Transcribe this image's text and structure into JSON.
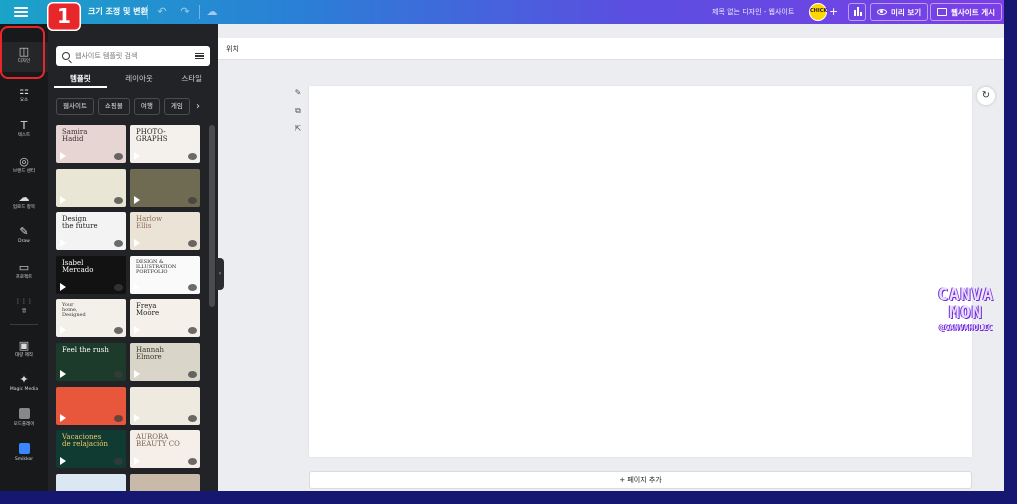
{
  "topbar": {
    "resize_label": "크기 조정 및 변환",
    "doc_title": "제목 없는 디자인 - 웹사이트",
    "avatar_text": "CHICK",
    "add_collaborator": "+",
    "preview_label": "미리 보기",
    "publish_label": "웹사이트 게시"
  },
  "step": {
    "number": "1"
  },
  "rail": {
    "items": [
      {
        "icon": "◫",
        "label": "디자인"
      },
      {
        "icon": "⚏",
        "label": "요소"
      },
      {
        "icon": "T",
        "label": "텍스트"
      },
      {
        "icon": "◎",
        "label": "브랜드 센터"
      },
      {
        "icon": "☁",
        "label": "업로드 항목"
      },
      {
        "icon": "✎",
        "label": "Draw"
      },
      {
        "icon": "▭",
        "label": "프로젝트"
      },
      {
        "icon": "⋮⋮⋮",
        "label": "앱"
      },
      {
        "icon": "▣",
        "label": "대량 제작"
      },
      {
        "icon": "✦",
        "label": "Magic Media"
      },
      {
        "icon": "■",
        "label": "모드플레이"
      },
      {
        "icon": "■",
        "label": "Smikkor"
      }
    ]
  },
  "panel": {
    "search_placeholder": "웹사이트 템플릿 검색",
    "tabs": [
      "템플릿",
      "레이아웃",
      "스타일"
    ],
    "chips": [
      "웹사이트",
      "쇼핑몰",
      "여행",
      "게임"
    ],
    "templates": [
      {
        "text": "Samira\nHadid",
        "bg": "#e7d5d3",
        "fg": "#3b2f2f"
      },
      {
        "text": "PHOTO-\nGRAPHS",
        "bg": "#f4f1ec",
        "fg": "#222"
      },
      {
        "text": "",
        "bg": "#eae6d5",
        "fg": "#6d6a55"
      },
      {
        "text": "",
        "bg": "#6e6b52",
        "fg": "#fff"
      },
      {
        "text": "Design\nthe future",
        "bg": "#f3f3f3",
        "fg": "#222"
      },
      {
        "text": "Harlow\nEllis",
        "bg": "#ece3d7",
        "fg": "#8b6d5a"
      },
      {
        "text": "Isabel\nMercado",
        "bg": "#121212",
        "fg": "#fff"
      },
      {
        "text": "DESIGN &\nILLUSTRATION\nPORTFOLIO",
        "bg": "#fafafa",
        "fg": "#222"
      },
      {
        "text": "Your\nhome,\nDesigned",
        "bg": "#f3efe9",
        "fg": "#333"
      },
      {
        "text": "Freya\nMoore",
        "bg": "#f5f1ea",
        "fg": "#222"
      },
      {
        "text": "Feel the rush",
        "bg": "#1d3b2a",
        "fg": "#fff"
      },
      {
        "text": "Hannah\nElmore",
        "bg": "#d9d5c8",
        "fg": "#3a3a2e"
      },
      {
        "text": "",
        "bg": "#e8573c",
        "fg": "#fff"
      },
      {
        "text": "",
        "bg": "#efeae0",
        "fg": "#5a5a4a"
      },
      {
        "text": "Vacaciones\nde relajación",
        "bg": "#0f3b33",
        "fg": "#f6c762"
      },
      {
        "text": "AURORA\nBEAUTY CO",
        "bg": "#f6eee8",
        "fg": "#7a5e4f"
      },
      {
        "text": "",
        "bg": "#dbe7f3",
        "fg": "#334"
      },
      {
        "text": "",
        "bg": "#c9b9a8",
        "fg": "#333"
      }
    ]
  },
  "editor": {
    "position_label": "위치",
    "add_page_label": "+ 페이지 추가"
  },
  "watermark": {
    "line1": "CANVA",
    "line2": "MON",
    "line3": "@CANVAHOLIC"
  },
  "colors": {
    "step_accent": "#e8272b",
    "rail_bg": "#18191b",
    "panel_bg": "#222326",
    "body_bg": "#161770"
  }
}
